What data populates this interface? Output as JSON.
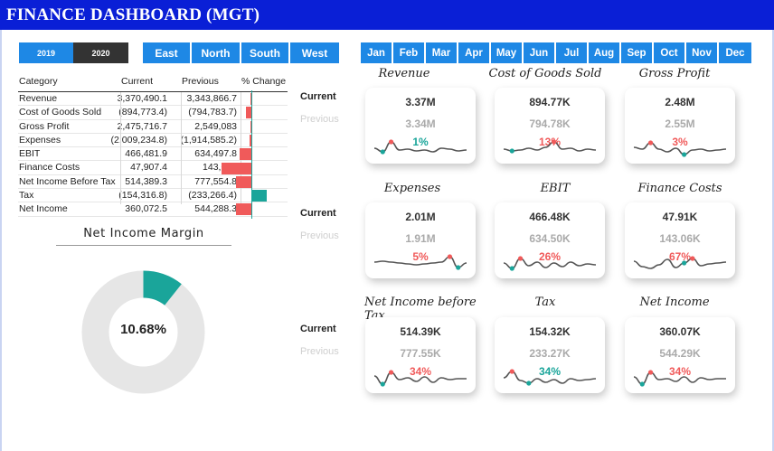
{
  "header": {
    "title": "FINANCE DASHBOARD (MGT)"
  },
  "years": [
    {
      "label": "2019",
      "selected": false
    },
    {
      "label": "2020",
      "selected": true
    }
  ],
  "regions": [
    "East",
    "North",
    "South",
    "West"
  ],
  "months": [
    "Jan",
    "Feb",
    "Mar",
    "Apr",
    "May",
    "Jun",
    "Jul",
    "Aug",
    "Sep",
    "Oct",
    "Nov",
    "Dec"
  ],
  "table": {
    "headers": {
      "category": "Category",
      "current": "Current",
      "previous": "Previous",
      "change": "% Change"
    },
    "rows": [
      {
        "category": "Revenue",
        "current": "3,370,490.1",
        "previous": "3,343,866.7",
        "change": 0.8
      },
      {
        "category": "Cost of Goods Sold",
        "current": "(894,773.4)",
        "previous": "(794,783.7)",
        "change": 12.6
      },
      {
        "category": "Gross Profit",
        "current": "2,475,716.7",
        "previous": "2,549,083",
        "change": -2.9
      },
      {
        "category": "Expenses",
        "current": "(2,009,234.8)",
        "previous": "(1,914,585.2)",
        "change": 4.9
      },
      {
        "category": "EBIT",
        "current": "466,481.9",
        "previous": "634,497.8",
        "change": -26.5
      },
      {
        "category": "Finance Costs",
        "current": "47,907.4",
        "previous": "143,057",
        "change": -66.5
      },
      {
        "category": "Net Income Before Tax",
        "current": "514,389.3",
        "previous": "777,554.8",
        "change": -33.8
      },
      {
        "category": "Tax",
        "current": "(154,316.8)",
        "previous": "(233,266.4)",
        "change": 33.8
      },
      {
        "category": "Net Income",
        "current": "360,072.5",
        "previous": "544,288.3",
        "change": -33.8
      }
    ]
  },
  "net_income_margin": {
    "title": "Net Income Margin",
    "label": "10.68%",
    "value": 10.68
  },
  "legend": {
    "current": "Current",
    "previous": "Previous"
  },
  "kpis": [
    {
      "title": "Revenue",
      "current": "3.37M",
      "previous": "3.34M",
      "change": "1%",
      "up": true,
      "spark": [
        0.55,
        0.35,
        0.9,
        0.45,
        0.5,
        0.4,
        0.45,
        0.35,
        0.55,
        0.5,
        0.4,
        0.45
      ],
      "hi": 1,
      "lo": 2
    },
    {
      "title": "Cost of Goods Sold",
      "current": "894.77K",
      "previous": "794.78K",
      "change": "13%",
      "up": false,
      "spark": [
        0.5,
        0.4,
        0.45,
        0.55,
        0.45,
        0.6,
        0.9,
        0.5,
        0.55,
        0.4,
        0.5,
        0.45
      ],
      "hi": 1,
      "lo": 6
    },
    {
      "title": "Gross Profit",
      "current": "2.48M",
      "previous": "2.55M",
      "change": "3%",
      "up": false,
      "spark": [
        0.6,
        0.5,
        0.85,
        0.5,
        0.35,
        0.55,
        0.2,
        0.45,
        0.5,
        0.4,
        0.45,
        0.5
      ],
      "hi": 6,
      "lo": 2
    },
    {
      "title": "Expenses",
      "current": "2.01M",
      "previous": "1.91M",
      "change": "5%",
      "up": false,
      "spark": [
        0.6,
        0.65,
        0.6,
        0.55,
        0.5,
        0.45,
        0.5,
        0.55,
        0.6,
        0.9,
        0.3,
        0.55
      ],
      "hi": 10,
      "lo": 9
    },
    {
      "title": "EBIT",
      "current": "466.48K",
      "previous": "634.50K",
      "change": "26%",
      "up": false,
      "spark": [
        0.55,
        0.25,
        0.8,
        0.4,
        0.6,
        0.3,
        0.55,
        0.35,
        0.6,
        0.4,
        0.5,
        0.45
      ],
      "hi": 1,
      "lo": 2
    },
    {
      "title": "Finance Costs",
      "current": "47.91K",
      "previous": "143.06K",
      "change": "67%",
      "up": false,
      "spark": [
        0.65,
        0.35,
        0.25,
        0.45,
        0.75,
        0.3,
        0.55,
        0.8,
        0.4,
        0.5,
        0.55,
        0.6
      ],
      "hi": 6,
      "lo": 7
    },
    {
      "title": "Net Income before Tax",
      "current": "514.39K",
      "previous": "777.55K",
      "change": "34%",
      "up": false,
      "spark": [
        0.65,
        0.2,
        0.85,
        0.45,
        0.55,
        0.35,
        0.6,
        0.3,
        0.55,
        0.45,
        0.5,
        0.5
      ],
      "hi": 1,
      "lo": 2
    },
    {
      "title": "Tax",
      "current": "154.32K",
      "previous": "233.27K",
      "change": "34%",
      "up": true,
      "spark": [
        0.55,
        0.9,
        0.4,
        0.25,
        0.5,
        0.3,
        0.45,
        0.25,
        0.5,
        0.4,
        0.45,
        0.5
      ],
      "hi": 3,
      "lo": 1
    },
    {
      "title": "Net Income",
      "current": "360.07K",
      "previous": "544.29K",
      "change": "34%",
      "up": false,
      "spark": [
        0.6,
        0.2,
        0.85,
        0.45,
        0.5,
        0.35,
        0.6,
        0.3,
        0.55,
        0.45,
        0.5,
        0.5
      ],
      "hi": 1,
      "lo": 2
    }
  ],
  "colors": {
    "accent": "#1e88e5",
    "header": "#0a1fd6",
    "up": "#1aa59a",
    "down": "#f05a5a",
    "spark": "#555555",
    "donut_track": "#e6e6e6"
  }
}
